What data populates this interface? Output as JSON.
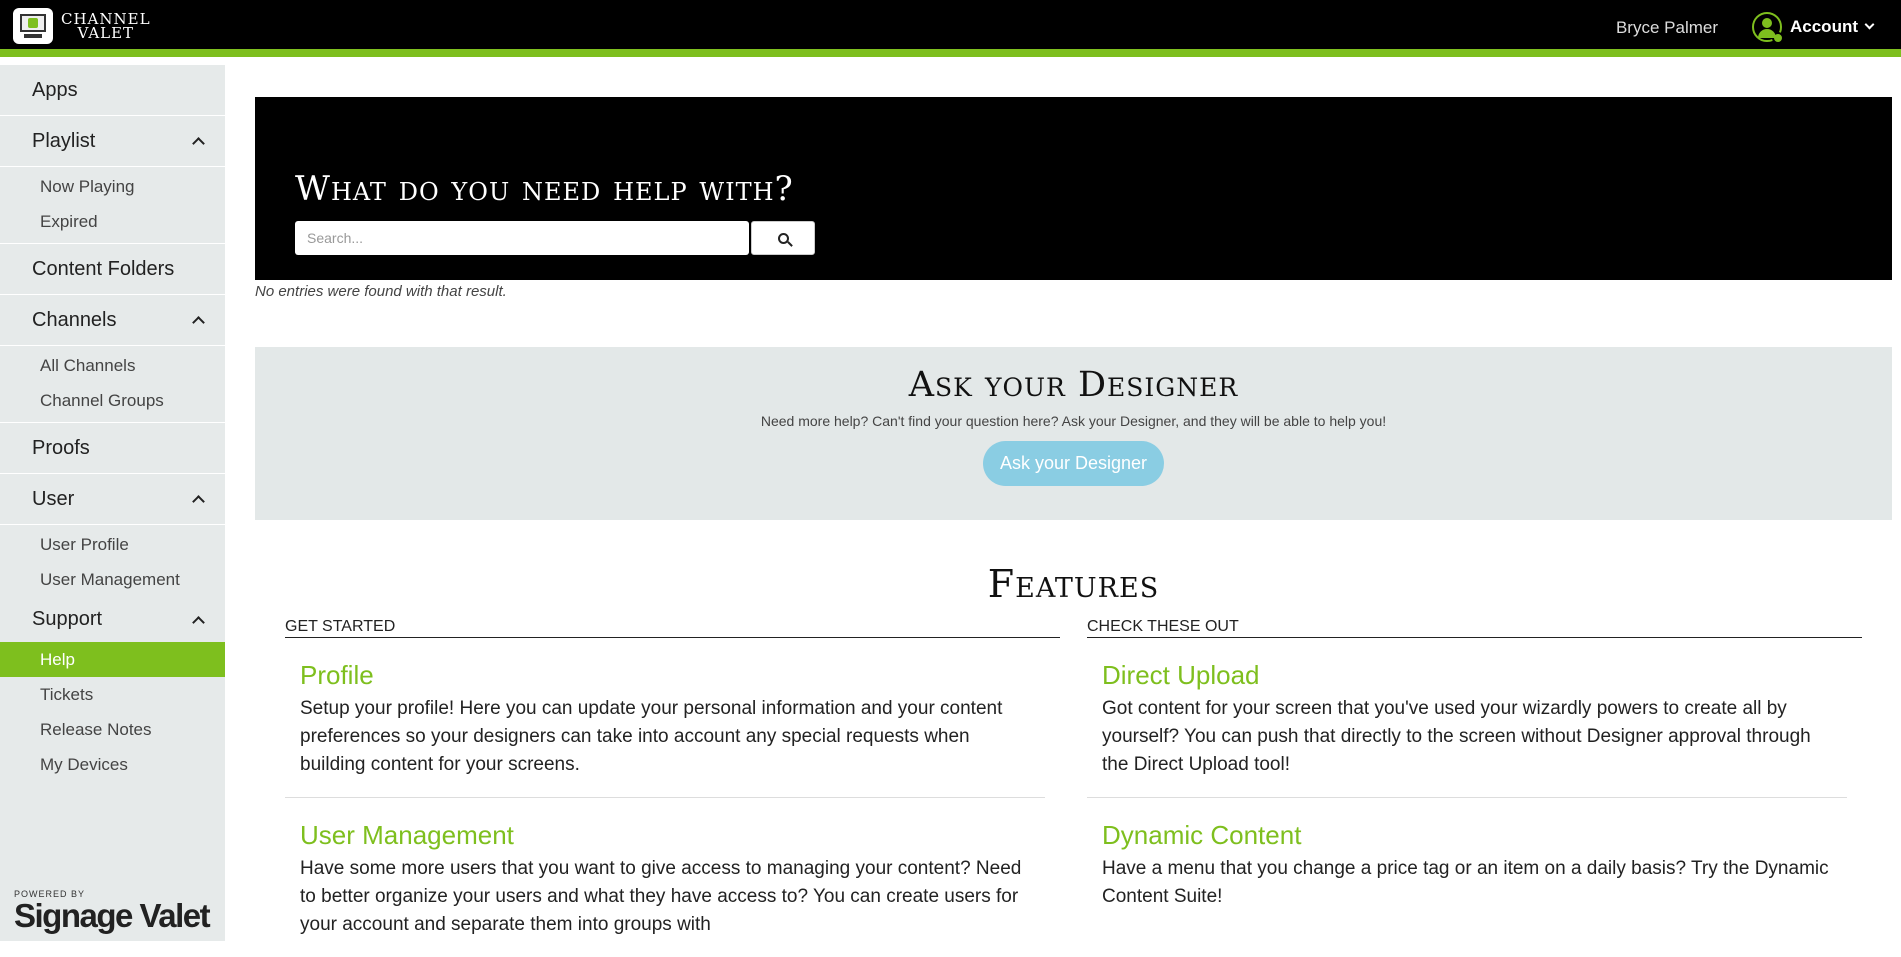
{
  "header": {
    "logo_line1": "CHANNEL",
    "logo_line2": "VALET",
    "user_name": "Bryce Palmer",
    "account_label": "Account"
  },
  "sidebar": {
    "apps": "Apps",
    "playlist": "Playlist",
    "playlist_items": [
      "Now Playing",
      "Expired"
    ],
    "content_folders": "Content Folders",
    "channels": "Channels",
    "channels_items": [
      "All Channels",
      "Channel Groups"
    ],
    "proofs": "Proofs",
    "user": "User",
    "user_items": [
      "User Profile",
      "User Management"
    ],
    "support": "Support",
    "support_items": [
      "Help",
      "Tickets",
      "Release Notes",
      "My Devices"
    ],
    "active_item": "Help",
    "powered_by": "POWERED BY",
    "brand": "Signage Valet"
  },
  "hero": {
    "title": "What do you need help with?",
    "search_placeholder": "Search...",
    "no_entries": "No entries were found with that result."
  },
  "ask": {
    "title": "Ask your Designer",
    "text": "Need more help? Can't find your question here? Ask your Designer, and they will be able to help you!",
    "button": "Ask your Designer"
  },
  "features": {
    "title": "Features",
    "left_heading": "GET STARTED",
    "right_heading": "CHECK THESE OUT",
    "left": [
      {
        "title": "Profile",
        "text": "Setup your profile! Here you can update your personal information and your content preferences so your designers can take into account any special requests when building content for your screens."
      },
      {
        "title": "User Management",
        "text": "Have some more users that you want to give access to managing your content? Need to better organize your users and what they have access to? You can create users for your account and separate them into groups with"
      }
    ],
    "right": [
      {
        "title": "Direct Upload",
        "text": "Got content for your screen that you've used your wizardly powers to create all by yourself? You can push that directly to the screen without Designer approval through the Direct Upload tool!"
      },
      {
        "title": "Dynamic Content",
        "text": "Have a menu that you change a price tag or an item on a daily basis? Try the Dynamic Content Suite!"
      }
    ]
  },
  "colors": {
    "accent": "#7ebf1e",
    "button_blue": "#8acde3",
    "sidebar_bg": "#e6eaea"
  }
}
